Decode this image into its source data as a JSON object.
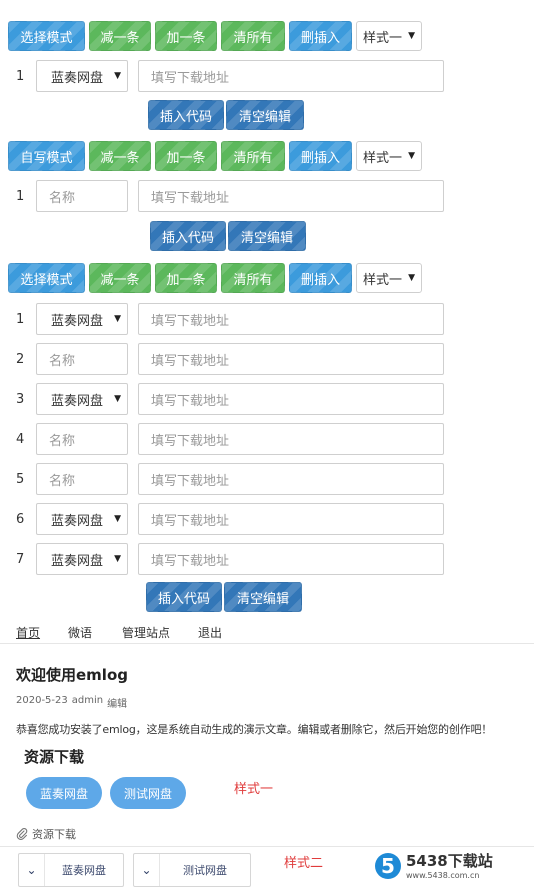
{
  "modes": {
    "select_label": "选择模式",
    "write_label": "自写模式"
  },
  "toolbar": {
    "minus_label": "减一条",
    "plus_label": "加一条",
    "clear_all_label": "清所有",
    "delete_insert_label": "删插入",
    "style_value": "样式一"
  },
  "editor": {
    "source_value": "蓝奏网盘",
    "name_placeholder": "名称",
    "url_placeholder": "填写下载地址",
    "insert_code_label": "插入代码",
    "clear_edit_label": "清空编辑"
  },
  "block1": {
    "rows": [
      {
        "num": "1",
        "kind": "select"
      }
    ]
  },
  "block2": {
    "rows": [
      {
        "num": "1",
        "kind": "name"
      }
    ]
  },
  "block3": {
    "rows": [
      {
        "num": "1",
        "kind": "select"
      },
      {
        "num": "2",
        "kind": "name"
      },
      {
        "num": "3",
        "kind": "select"
      },
      {
        "num": "4",
        "kind": "name"
      },
      {
        "num": "5",
        "kind": "name"
      },
      {
        "num": "6",
        "kind": "select"
      },
      {
        "num": "7",
        "kind": "select"
      }
    ]
  },
  "nav": {
    "home": "首页",
    "weibo": "微语",
    "manage": "管理站点",
    "logout": "退出"
  },
  "post": {
    "title": "欢迎使用emlog",
    "date": "2020-5-23",
    "author": "admin",
    "edit": "编辑",
    "body": "恭喜您成功安装了emlog，这是系统自动生成的演示文章。编辑或者删除它，然后开始您的创作吧！"
  },
  "resource": {
    "title": "资源下载",
    "btn_lanzou": "蓝奏网盘",
    "btn_test": "测试网盘",
    "style1_label": "样式一",
    "dl_label": "资源下载",
    "style2_label": "样式二"
  },
  "watermark": {
    "logo_digit": "5",
    "main": "5438下载站",
    "sub": "www.5438.com.cn"
  },
  "colors": {
    "blue": "#3c9bdc",
    "green": "#5cb85c",
    "dark_blue": "#3377b8",
    "pill_blue": "#5ea8e8",
    "style_red": "#e03c3c"
  }
}
